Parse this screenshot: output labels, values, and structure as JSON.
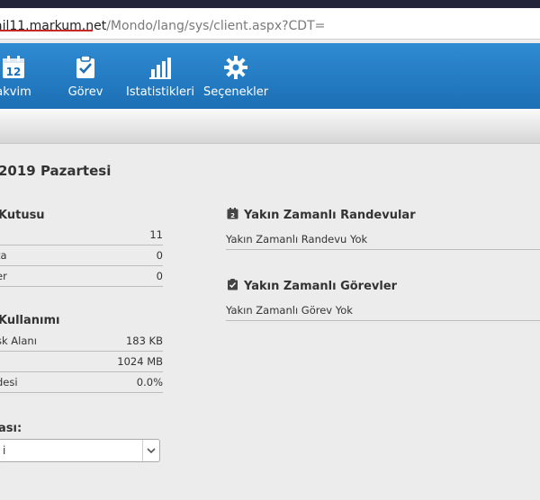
{
  "browser": {
    "url_host": "ail11.markum.net",
    "url_path": "/Mondo/lang/sys/client.aspx?CDT="
  },
  "nav": {
    "items": [
      {
        "label": "akvim",
        "icon": "calendar-icon"
      },
      {
        "label": "Görev",
        "icon": "clipboard-check-icon"
      },
      {
        "label": "Istatistikleri",
        "icon": "bar-chart-icon"
      },
      {
        "label": "Seçenekler",
        "icon": "gear-icon"
      }
    ],
    "calendar_day": "12"
  },
  "main": {
    "date_title": "2019 Pazartesi"
  },
  "inbox": {
    "title": "Kutusu",
    "rows": [
      {
        "key": ":",
        "value": "11"
      },
      {
        "key": "ta",
        "value": "0"
      },
      {
        "key": "er",
        "value": "0"
      }
    ]
  },
  "usage": {
    "title": "Kullanımı",
    "rows": [
      {
        "key": "sk Alanı",
        "value": "183 KB"
      },
      {
        "key": "",
        "value": "1024 MB"
      },
      {
        "key": "desi",
        "value": "0.0%"
      }
    ]
  },
  "language": {
    "label": "ası:",
    "selected": "i"
  },
  "appointments": {
    "title": "Yakın Zamanlı Randevular",
    "empty_text": "Yakın Zamanlı Randevu Yok",
    "icon_day": "2"
  },
  "tasks": {
    "title": "Yakın Zamanlı Görevler",
    "empty_text": "Yakın Zamanlı Görev Yok"
  }
}
